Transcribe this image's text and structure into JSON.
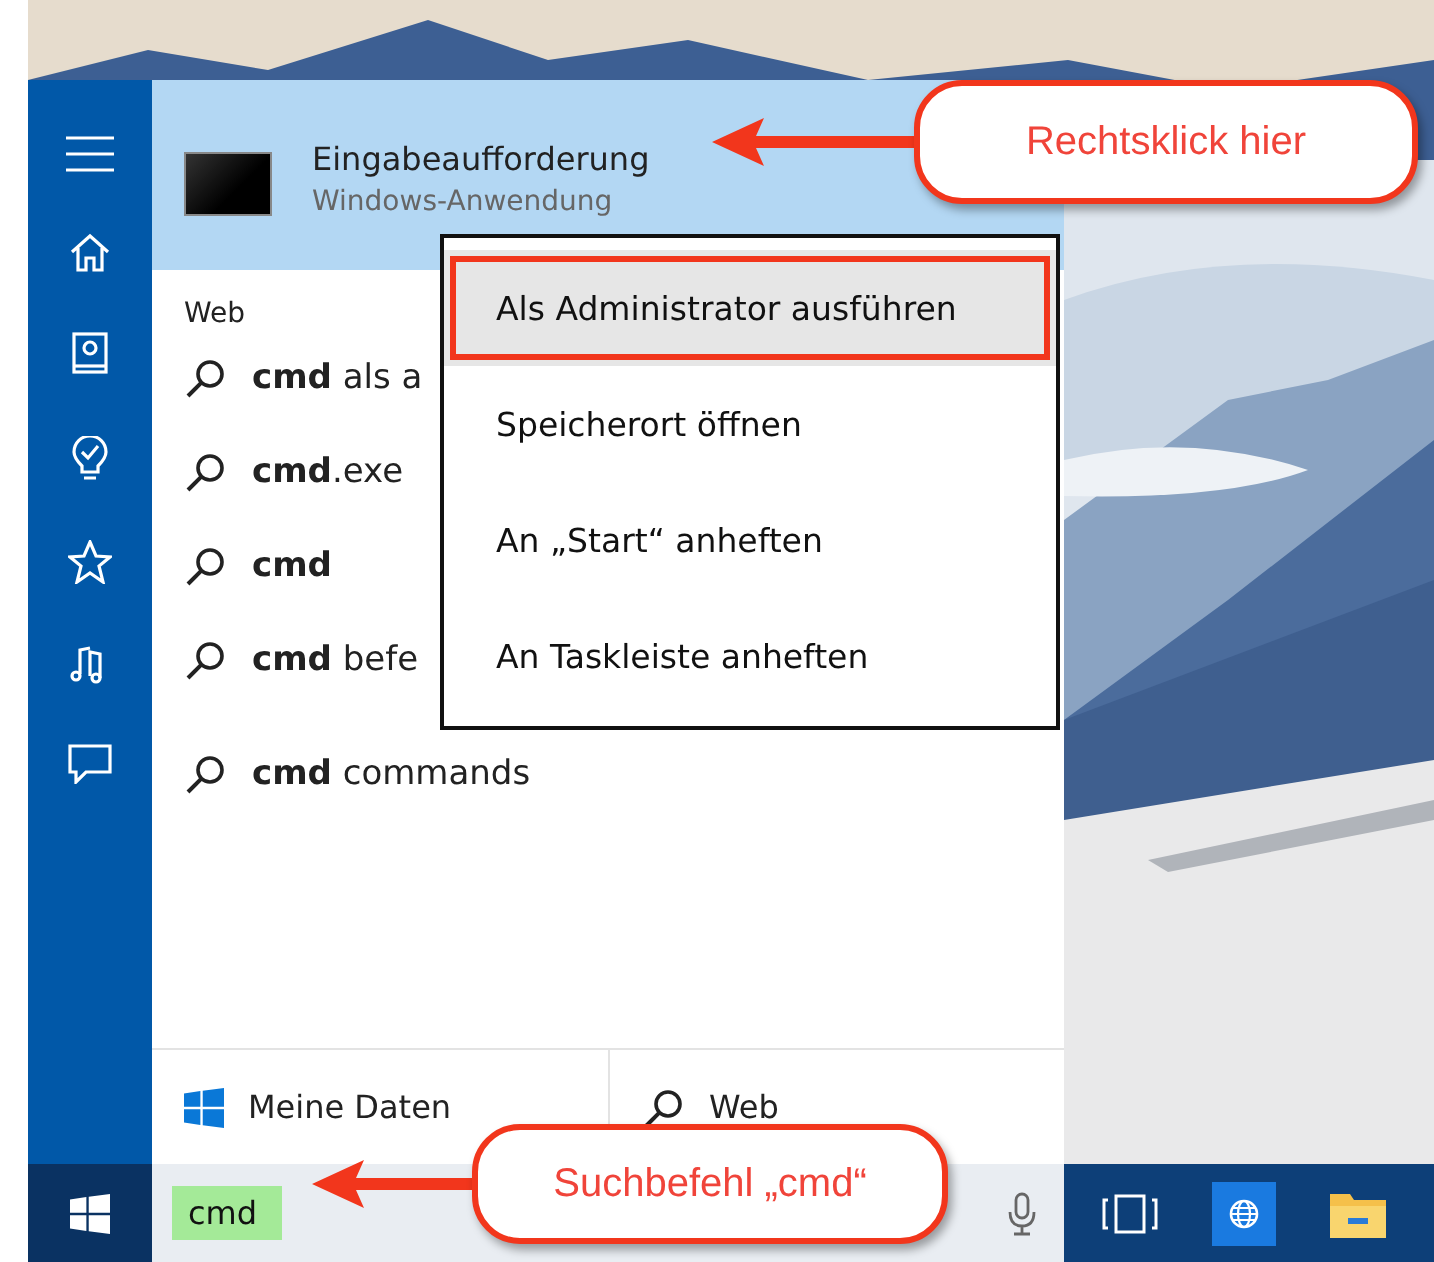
{
  "best_match": {
    "title": "Eingabeaufforderung",
    "subtitle": "Windows-Anwendung",
    "selected": true
  },
  "section_label": "Web",
  "results": [
    {
      "text": "**cmd** als a"
    },
    {
      "text": "**cmd**.exe"
    },
    {
      "text": "**cmd**"
    },
    {
      "text": "**cmd** befe"
    },
    {
      "text": "**cmd** commands"
    }
  ],
  "context_menu": {
    "items": [
      {
        "label": "Als Administrator ausführen",
        "selected": true
      },
      {
        "label": "Speicherort öffnen",
        "selected": false
      },
      {
        "label": "An „Start“ anheften",
        "selected": false
      },
      {
        "label": "An Taskleiste anheften",
        "selected": false
      }
    ]
  },
  "scope_buttons": [
    {
      "label": "Meine Daten",
      "kind": "windows"
    },
    {
      "label": "Web",
      "kind": "search"
    }
  ],
  "search_box": {
    "value": "cmd",
    "highlighted": true
  },
  "callouts": [
    {
      "text": "Rechtsklick hier",
      "kind": "top"
    },
    {
      "text": "Suchbefehl „cmd“",
      "kind": "bottom"
    }
  ]
}
